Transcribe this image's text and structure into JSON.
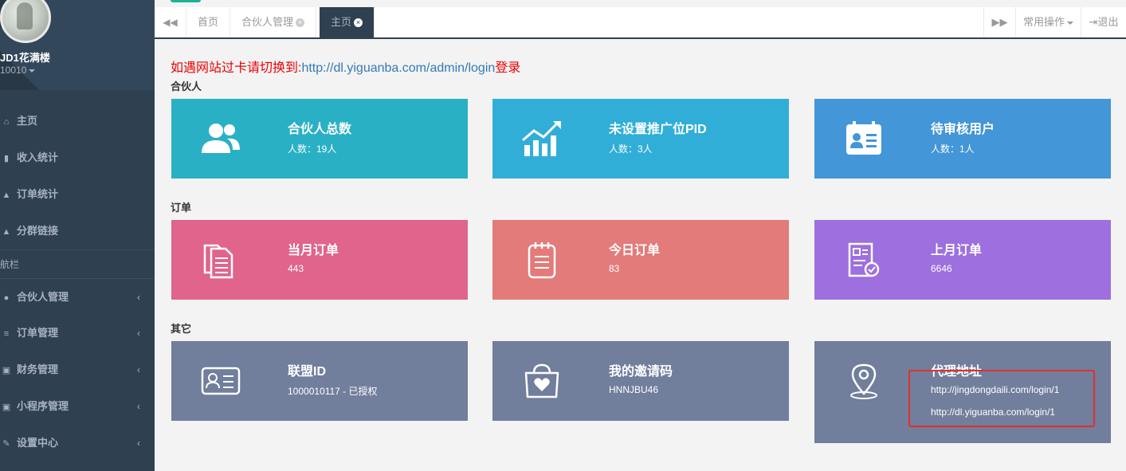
{
  "sidebar": {
    "user": {
      "name": "JD1花满楼",
      "id": "10010"
    },
    "items": [
      {
        "label": "主页",
        "icon": "home-icon"
      },
      {
        "label": "收入统计",
        "icon": "bar-chart-icon"
      },
      {
        "label": "订单统计",
        "icon": "area-chart-icon"
      },
      {
        "label": "分群链接",
        "icon": "area-chart-icon"
      }
    ],
    "section_label": "航栏",
    "menus": [
      {
        "label": "合伙人管理",
        "icon": "users-icon"
      },
      {
        "label": "订单管理",
        "icon": "list-icon"
      },
      {
        "label": "财务管理",
        "icon": "money-icon"
      },
      {
        "label": "小程序管理",
        "icon": "money-icon"
      },
      {
        "label": "设置中心",
        "icon": "edit-icon"
      }
    ]
  },
  "tabs": {
    "items": [
      "首页",
      "合伙人管理",
      "主页"
    ],
    "active": "主页",
    "common_ops": "常用操作",
    "logout": "退出"
  },
  "notice": {
    "prefix": "如遇网站过卡请切换到:",
    "url": "http://dl.yiguanba.com/admin/login",
    "suffix": "登录"
  },
  "sections": {
    "partners": "合伙人",
    "orders": "订单",
    "others": "其它"
  },
  "cards": {
    "partner_total": {
      "title": "合伙人总数",
      "sub": "人数：19人",
      "color": "#2ab0c5"
    },
    "no_pid": {
      "title": "未设置推广位PID",
      "sub": "人数：3人",
      "color": "#31aed8"
    },
    "pending_users": {
      "title": "待审核用户",
      "sub": "人数：1人",
      "color": "#4396d7"
    },
    "month_orders": {
      "title": "当月订单",
      "sub": "443",
      "color": "#e0648b"
    },
    "today_orders": {
      "title": "今日订单",
      "sub": "83",
      "color": "#e27b79"
    },
    "last_month_orders": {
      "title": "上月订单",
      "sub": "6646",
      "color": "#9d6fdf"
    },
    "union_id": {
      "title": "联盟ID",
      "sub": "1000010117 - 已授权",
      "color": "#717e9c"
    },
    "invite_code": {
      "title": "我的邀请码",
      "sub": "HNNJBU46",
      "color": "#717e9c"
    },
    "agent_address": {
      "title": "代理地址",
      "url1": "http://jingdongdaili.com/login/1",
      "url2": "http://dl.yiguanba.com/login/1",
      "color": "#717e9c"
    }
  }
}
